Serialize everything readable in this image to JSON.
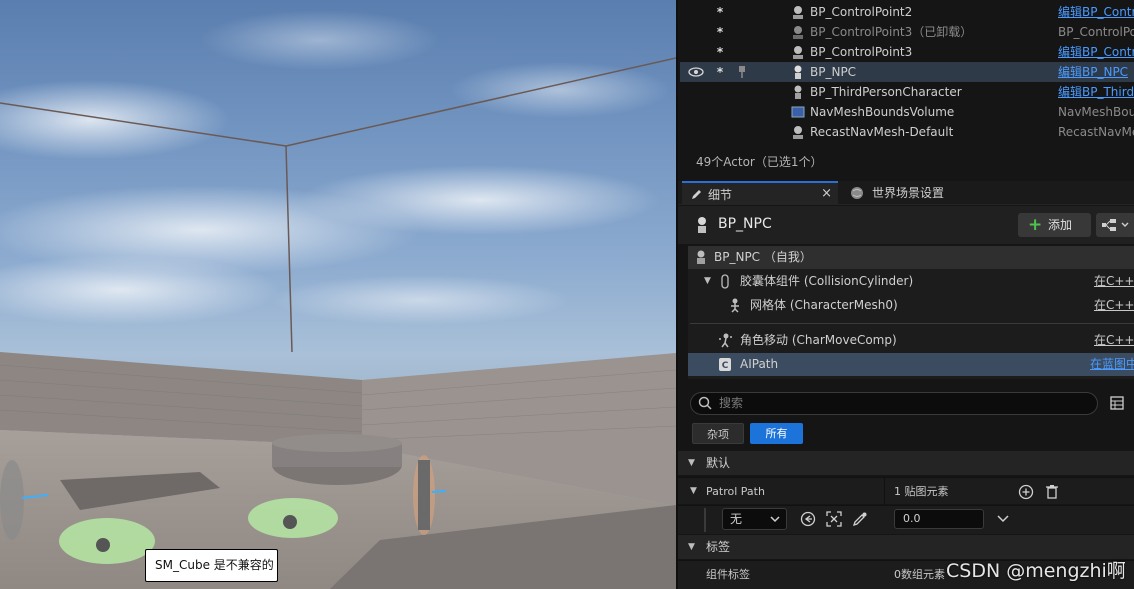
{
  "outliner": {
    "rows": [
      {
        "name": "BP_ControlPoint2",
        "type": "编辑BP_Contr",
        "type_style": "link",
        "star": "*",
        "dim": false
      },
      {
        "name": "BP_ControlPoint3（已卸载）",
        "type": "BP_ControlPoi",
        "type_style": "plain",
        "star": "*",
        "dim": true
      },
      {
        "name": "BP_ControlPoint3",
        "type": "编辑BP_Contr",
        "type_style": "link",
        "star": "*",
        "dim": false
      },
      {
        "name": "BP_NPC",
        "type": "编辑BP_NPC",
        "type_style": "link",
        "star": "*",
        "dim": false
      },
      {
        "name": "BP_ThirdPersonCharacter",
        "type": "编辑BP_Third",
        "type_style": "link",
        "star": "",
        "dim": false
      },
      {
        "name": "NavMeshBoundsVolume",
        "type": "NavMeshBour",
        "type_style": "plain",
        "star": "",
        "dim": false
      },
      {
        "name": "RecastNavMesh-Default",
        "type": "RecastNavMe",
        "type_style": "plain",
        "star": "",
        "dim": false
      }
    ],
    "actor_count": "49个Actor（已选1个）"
  },
  "tabs": {
    "details": "细节",
    "close": "×",
    "world_settings": "世界场景设置"
  },
  "details": {
    "title": "BP_NPC",
    "add_label": "添加"
  },
  "components": [
    {
      "label": "BP_NPC （自我）",
      "link": ""
    },
    {
      "label": "胶囊体组件 (CollisionCylinder)",
      "link": "在C++中"
    },
    {
      "label": "网格体 (CharacterMesh0)",
      "link": "在C++中"
    },
    {
      "label": "角色移动 (CharMoveComp)",
      "link": "在C++中"
    },
    {
      "label": "AIPath",
      "link": "在蓝图中"
    }
  ],
  "search": {
    "placeholder": "搜索"
  },
  "filters": {
    "misc": "杂项",
    "all": "所有"
  },
  "sections": {
    "default": "默认",
    "tags": "标签"
  },
  "properties": {
    "patrol_path_label": "Patrol Path",
    "patrol_path_value": "1 贴图元素",
    "element_select": "无",
    "element_value": "0.0",
    "component_tags_label": "组件标签",
    "component_tags_value": "0数组元素"
  },
  "viewport": {
    "tooltip": "SM_Cube 是不兼容的"
  },
  "watermark": "CSDN @mengzhi啊",
  "colors": {
    "accent": "#1c73d9",
    "link": "#4a9bff",
    "selection": "#2f3a48"
  }
}
